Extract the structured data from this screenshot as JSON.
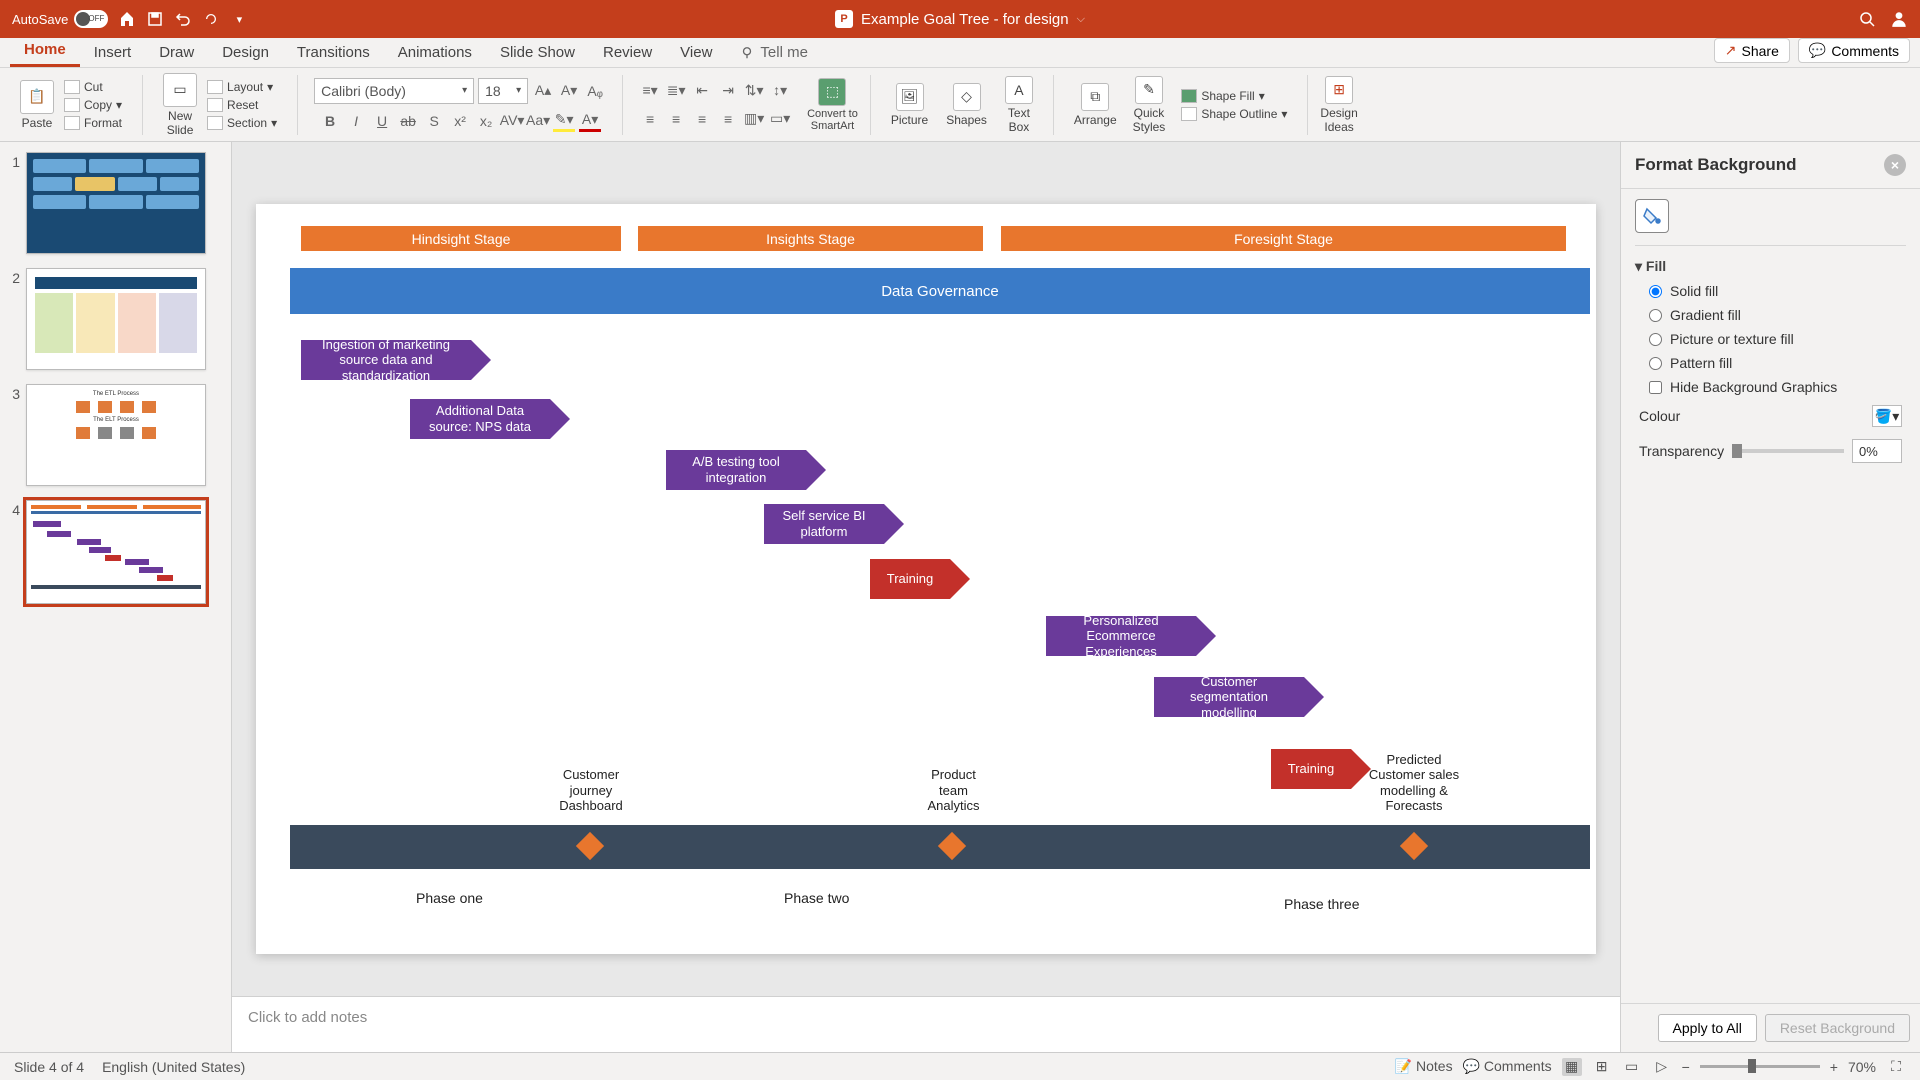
{
  "titlebar": {
    "autosave": "AutoSave",
    "autosave_state": "OFF",
    "doc_title": "Example Goal Tree - for design"
  },
  "tabs": {
    "home": "Home",
    "insert": "Insert",
    "draw": "Draw",
    "design": "Design",
    "transitions": "Transitions",
    "animations": "Animations",
    "slideshow": "Slide Show",
    "review": "Review",
    "view": "View",
    "tellme": "Tell me",
    "share": "Share",
    "comments": "Comments"
  },
  "ribbon": {
    "paste": "Paste",
    "cut": "Cut",
    "copy": "Copy",
    "format": "Format",
    "newslide": "New\nSlide",
    "layout": "Layout",
    "reset": "Reset",
    "section": "Section",
    "font_name": "Calibri (Body)",
    "font_size": "18",
    "convert": "Convert to\nSmartArt",
    "picture": "Picture",
    "shapes": "Shapes",
    "textbox": "Text\nBox",
    "arrange": "Arrange",
    "quickstyles": "Quick\nStyles",
    "shapefill": "Shape Fill",
    "shapeoutline": "Shape Outline",
    "designideas": "Design\nIdeas"
  },
  "slide": {
    "stage1": "Hindsight  Stage",
    "stage2": "Insights Stage",
    "stage3": "Foresight Stage",
    "gov": "Data Governance",
    "c1": "Ingestion of marketing source data and standardization",
    "c2": "Additional Data source: NPS data",
    "c3": "A/B testing tool integration",
    "c4": "Self service BI platform",
    "c5": "Training",
    "c6": "Personalized Ecommerce Experiences",
    "c7": "Customer segmentation modelling",
    "c8": "Training",
    "lbl1": "Customer journey Dashboard",
    "lbl2": "Product team Analytics",
    "lbl3": "Predicted Customer sales modelling  & Forecasts",
    "p1": "Phase one",
    "p2": "Phase two",
    "p3": "Phase three"
  },
  "notes_placeholder": "Click to add notes",
  "pane": {
    "title": "Format Background",
    "fill": "Fill",
    "solid": "Solid fill",
    "gradient": "Gradient fill",
    "picture": "Picture or texture fill",
    "pattern": "Pattern fill",
    "hide": "Hide Background Graphics",
    "colour": "Colour",
    "transparency": "Transparency",
    "transp_val": "0%",
    "apply": "Apply to All",
    "reset": "Reset Background"
  },
  "status": {
    "slide": "Slide 4 of 4",
    "lang": "English (United States)",
    "notes": "Notes",
    "comments": "Comments",
    "zoom": "70%"
  },
  "thumbs": {
    "n1": "1",
    "n2": "2",
    "n3": "3",
    "n4": "4"
  }
}
